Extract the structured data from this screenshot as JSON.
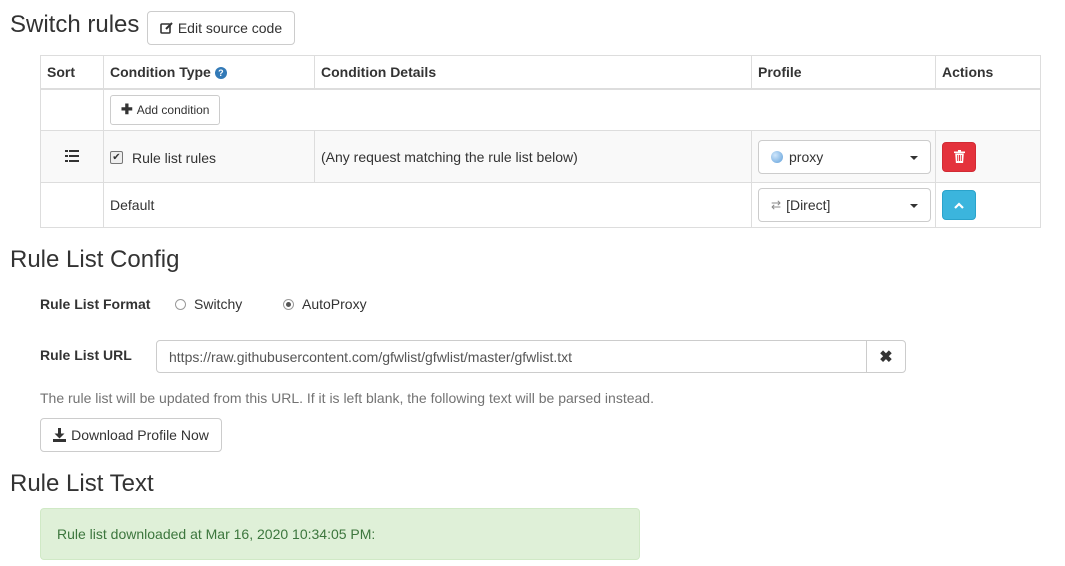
{
  "header": {
    "title": "Switch rules",
    "edit_source_label": "Edit source code"
  },
  "rules_table": {
    "columns": [
      "Sort",
      "Condition Type",
      "Condition Details",
      "Profile",
      "Actions"
    ],
    "add_condition_label": "Add condition",
    "rule_row": {
      "condition_type": "Rule list rules",
      "checked": true,
      "condition_details": "(Any request matching the rule list below)",
      "profile": "proxy",
      "profile_icon": "globe-icon"
    },
    "default_row": {
      "label": "Default",
      "profile": "[Direct]",
      "profile_icon": "exchange-icon"
    }
  },
  "rule_list_config": {
    "title": "Rule List Config",
    "format_label": "Rule List Format",
    "format_options": [
      "Switchy",
      "AutoProxy"
    ],
    "format_selected": "AutoProxy",
    "url_label": "Rule List URL",
    "url_value": "https://raw.githubusercontent.com/gfwlist/gfwlist/master/gfwlist.txt",
    "help_text": "The rule list will be updated from this URL. If it is left blank, the following text will be parsed instead.",
    "download_label": "Download Profile Now"
  },
  "rule_list_text": {
    "title": "Rule List Text",
    "status_message": "Rule list downloaded at Mar 16, 2020 10:34:05 PM:"
  },
  "colors": {
    "danger": "#e4323c",
    "info": "#3bb5dd",
    "success_bg": "#dff0d8",
    "success_text": "#3c763d"
  }
}
